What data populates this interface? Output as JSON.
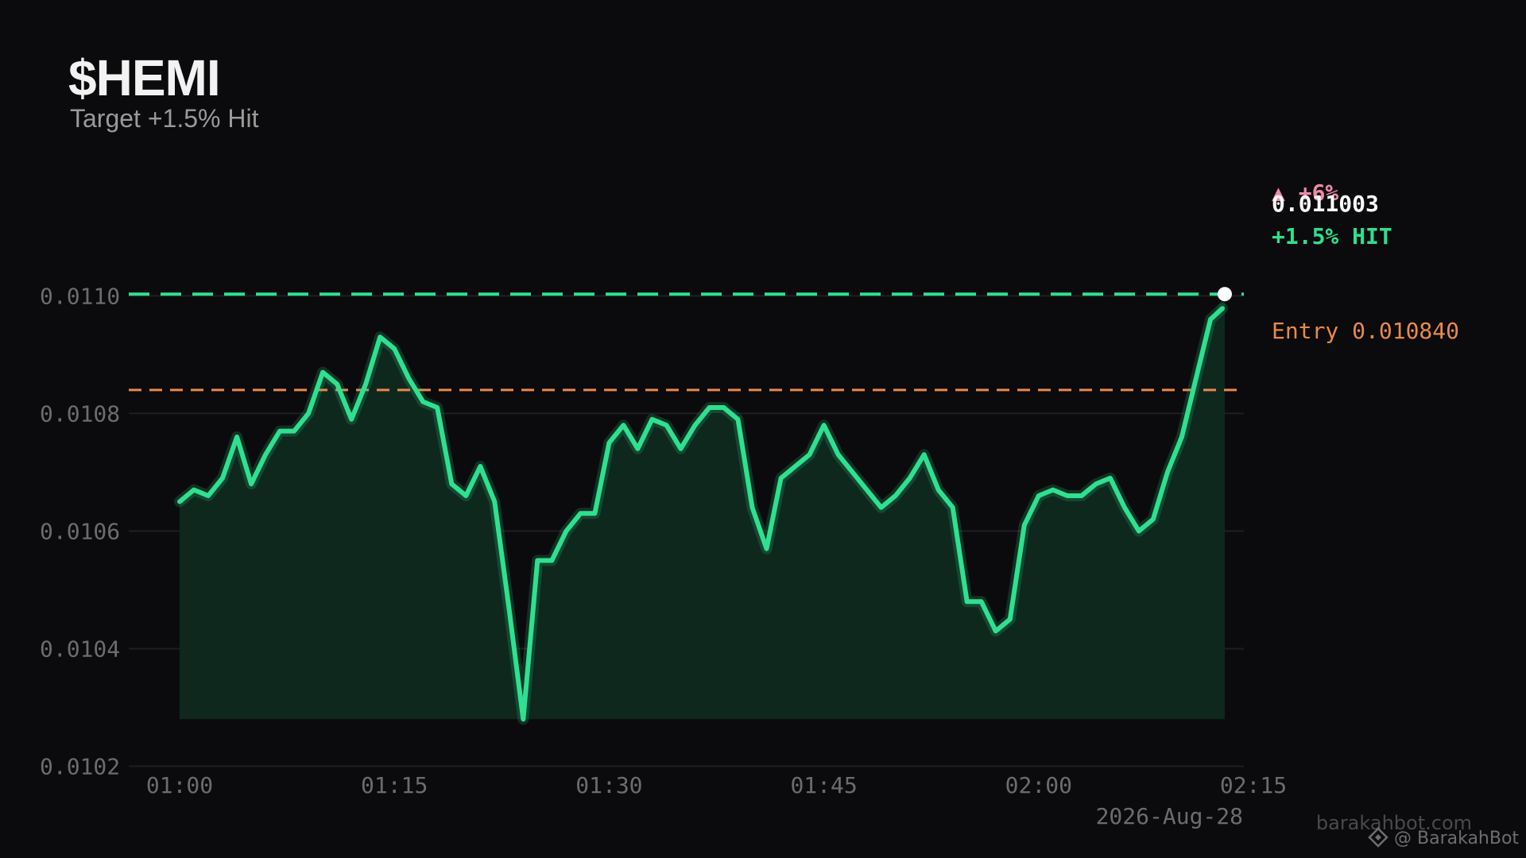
{
  "header": {
    "title": "$HEMI",
    "subtitle": "Target +1.5% Hit"
  },
  "annotations": {
    "change_badge": "▲ +6%",
    "current_price": "0.011003",
    "target_label": "+1.5%  HIT",
    "entry_label": "Entry 0.010840"
  },
  "footer": {
    "date": "2026-Aug-28",
    "site": "barakahbot.com",
    "handle": "@ BarakahBot"
  },
  "colors": {
    "background": "#0b0b0d",
    "line": "#2ee08f",
    "fill": "#0f2a20",
    "target": "#2ee08f",
    "entry": "#e8894a",
    "badge": "#f08aa5",
    "grid": "#1f1f22"
  },
  "chart_data": {
    "type": "area",
    "title": "$HEMI",
    "subtitle": "Target +1.5% Hit",
    "xlabel": "",
    "ylabel": "",
    "x_ticks": [
      "01:00",
      "01:15",
      "01:30",
      "01:45",
      "02:00",
      "02:15"
    ],
    "x_range": [
      "01:00",
      "02:15"
    ],
    "y_ticks": [
      "0.0102",
      "0.0104",
      "0.0106",
      "0.0108",
      "0.0110"
    ],
    "ylim": [
      0.0101,
      0.01112
    ],
    "grid": true,
    "target_price": 0.011003,
    "entry_price": 0.01084,
    "target_label": "+1.5%  HIT",
    "entry_label": "Entry 0.010840",
    "series": [
      {
        "x": [
          "01:00",
          "01:01",
          "01:02",
          "01:03",
          "01:04",
          "01:05",
          "01:06",
          "01:07",
          "01:08",
          "01:09",
          "01:10",
          "01:11",
          "01:12",
          "01:13",
          "01:14",
          "01:15",
          "01:16",
          "01:17",
          "01:18",
          "01:19",
          "01:20",
          "01:21",
          "01:22",
          "01:23",
          "01:24",
          "01:25",
          "01:26",
          "01:27",
          "01:28",
          "01:29",
          "01:30",
          "01:31",
          "01:32",
          "01:33",
          "01:34",
          "01:35",
          "01:36",
          "01:37",
          "01:38",
          "01:39",
          "01:40",
          "01:41",
          "01:42",
          "01:43",
          "01:44",
          "01:45",
          "01:46",
          "01:47",
          "01:48",
          "01:49",
          "01:50",
          "01:51",
          "01:52",
          "01:53",
          "01:54",
          "01:55",
          "01:56",
          "01:57",
          "01:58",
          "01:59",
          "02:00",
          "02:01",
          "02:02",
          "02:03",
          "02:04",
          "02:05",
          "02:06",
          "02:07",
          "02:08",
          "02:09",
          "02:10",
          "02:11",
          "02:12",
          "02:13"
        ],
        "values": [
          0.01065,
          0.01067,
          0.01066,
          0.01069,
          0.01076,
          0.01068,
          0.01073,
          0.01077,
          0.01077,
          0.0108,
          0.01087,
          0.01085,
          0.01079,
          0.01085,
          0.01093,
          0.01091,
          0.01086,
          0.01082,
          0.01081,
          0.01068,
          0.01066,
          0.01071,
          0.01065,
          0.01047,
          0.01028,
          0.01055,
          0.01055,
          0.0106,
          0.01063,
          0.01063,
          0.01075,
          0.01078,
          0.01074,
          0.01079,
          0.01078,
          0.01074,
          0.01078,
          0.01081,
          0.01081,
          0.01079,
          0.01064,
          0.01057,
          0.01069,
          0.01071,
          0.01073,
          0.01078,
          0.01073,
          0.0107,
          0.01067,
          0.01064,
          0.01066,
          0.01069,
          0.01073,
          0.01067,
          0.01064,
          0.01048,
          0.01048,
          0.01043,
          0.01045,
          0.01061,
          0.01066,
          0.01067,
          0.01066,
          0.01066,
          0.01068,
          0.01069,
          0.01064,
          0.0106,
          0.01062,
          0.0107,
          0.01076,
          0.01086,
          0.01096,
          0.011003
        ]
      }
    ]
  }
}
